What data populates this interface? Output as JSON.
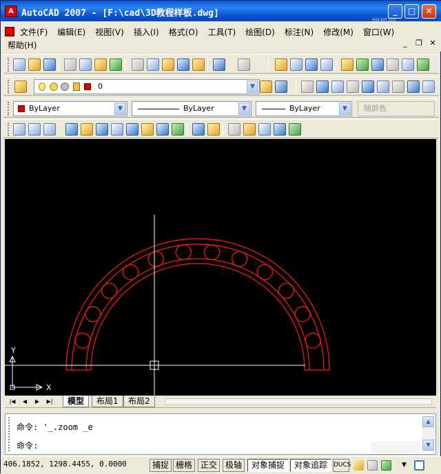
{
  "window": {
    "title": "AutoCAD 2007 - [F:\\cad\\3D教程样板.dwg]",
    "app_icon_text": "A",
    "watermark": "搜狐网",
    "min_glyph": "_",
    "max_glyph": "□",
    "close_glyph": "✕"
  },
  "menu": {
    "items": [
      "文件(F)",
      "编辑(E)",
      "视图(V)",
      "插入(I)",
      "格式(O)",
      "工具(T)",
      "绘图(D)",
      "标注(N)",
      "修改(M)",
      "窗口(W)"
    ],
    "help": "帮助(H)",
    "inner_controls": [
      "_",
      "❐",
      "✕"
    ]
  },
  "layer_toolbar": {
    "current_layer": "0",
    "drop_glyph": "▼"
  },
  "properties_toolbar": {
    "color": "ByLayer",
    "linetype": "ByLayer",
    "lineweight": "ByLayer",
    "plotstyle": "随颜色",
    "color_swatch": "#dd0000"
  },
  "canvas": {
    "background": "#000000",
    "drawing_color": "#ff1a1a",
    "crosshair_color": "#ffffff",
    "ucs_x_label": "X",
    "ucs_y_label": "Y"
  },
  "layout_tabs": {
    "tabs": [
      "模型",
      "布局1",
      "布局2"
    ],
    "active": "模型",
    "nav_glyphs": [
      "|◀",
      "◀",
      "▶",
      "▶|"
    ]
  },
  "command": {
    "history": "命令: '_.zoom _e",
    "prompt": "命令:",
    "scroll_up": "▲",
    "scroll_down": "▼"
  },
  "status": {
    "coordinates": "406.1852, 1298.4455, 0.0000",
    "buttons": [
      "捕捉",
      "栅格",
      "正交",
      "极轴",
      "对象捕捉",
      "对象追踪",
      "DUCS"
    ],
    "pressed": [
      "对象捕捉",
      "对象追踪"
    ]
  }
}
